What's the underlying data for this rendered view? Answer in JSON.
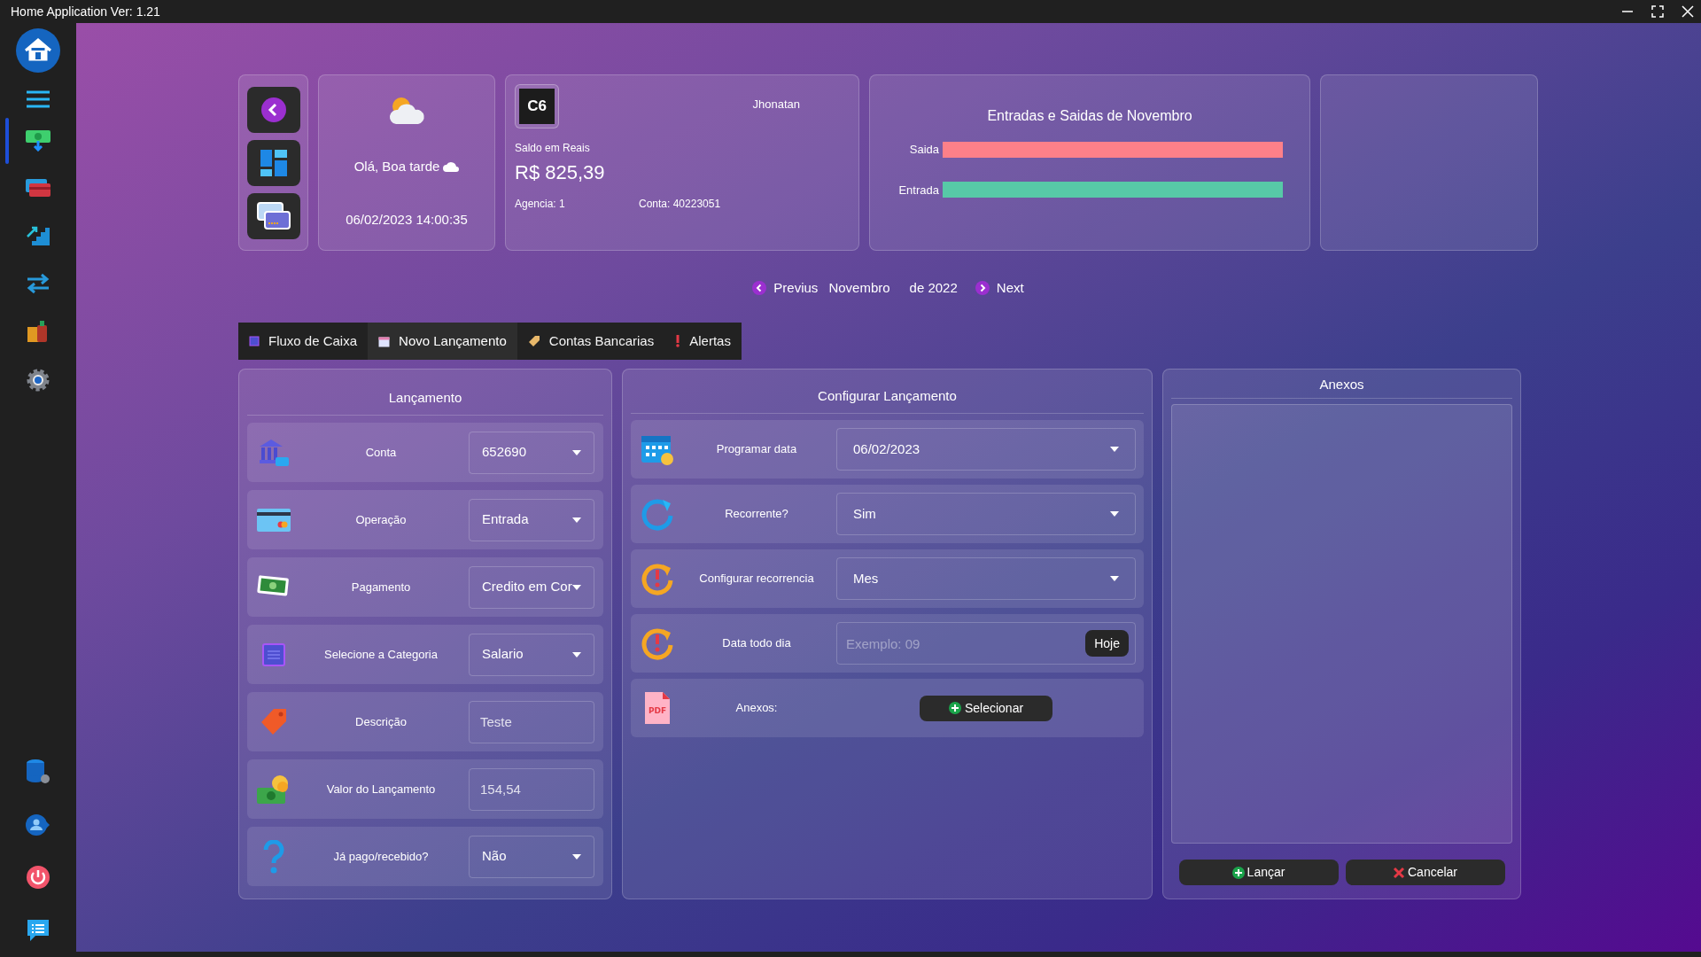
{
  "window": {
    "title": "Home Application Ver: 1.21"
  },
  "sidebar": {
    "items": [
      {
        "selected": true
      },
      {
        "selected": false
      },
      {
        "selected": false
      },
      {
        "selected": false
      },
      {
        "selected": false
      },
      {
        "selected": false
      }
    ]
  },
  "greeting": {
    "text": "Olá, Boa tarde",
    "datetime": "06/02/2023 14:00:35"
  },
  "bank_card": {
    "logo": "C6",
    "owner": "Jhonatan",
    "balance_label": "Saldo em Reais",
    "balance": "R$ 825,39",
    "agency": "Agencia: 1",
    "account": "Conta: 40223051"
  },
  "summary_chart": {
    "title": "Entradas e Saidas de Novembro",
    "bars": [
      {
        "label": "Saida",
        "color": "#fd8089"
      },
      {
        "label": "Entrada",
        "color": "#57c9a7"
      }
    ]
  },
  "pager": {
    "previous": "Previus",
    "month": "Novembro",
    "year": "de 2022",
    "next": "Next"
  },
  "tabs": [
    {
      "label": "Fluxo de Caixa",
      "selected": false
    },
    {
      "label": "Novo Lançamento",
      "selected": true
    },
    {
      "label": "Contas Bancarias",
      "selected": false
    },
    {
      "label": "Alertas",
      "selected": false
    }
  ],
  "entry_panel": {
    "title": "Lançamento",
    "rows": [
      {
        "label": "Conta",
        "kind": "select",
        "value": "652690"
      },
      {
        "label": "Operação",
        "kind": "select",
        "value": "Entrada"
      },
      {
        "label": "Pagamento",
        "kind": "select",
        "value": "Credito em Cor"
      },
      {
        "label": "Selecione a Categoria",
        "kind": "select",
        "value": "Salario"
      },
      {
        "label": "Descrição",
        "kind": "input",
        "value": "Teste"
      },
      {
        "label": "Valor do Lançamento",
        "kind": "input",
        "value": "154,54"
      },
      {
        "label": "Já pago/recebido?",
        "kind": "select",
        "value": "Não"
      }
    ]
  },
  "config_panel": {
    "title": "Configurar Lançamento",
    "rows": [
      {
        "label": "Programar data",
        "kind": "select",
        "value": "06/02/2023"
      },
      {
        "label": "Recorrente?",
        "kind": "select",
        "value": "Sim"
      },
      {
        "label": "Configurar recorrencia",
        "kind": "select",
        "value": "Mes"
      },
      {
        "label": "Data todo dia",
        "kind": "input_button",
        "placeholder": "Exemplo: 09",
        "button": "Hoje"
      },
      {
        "label": "Anexos:",
        "kind": "button",
        "button": "Selecionar",
        "icon_text": "PDF"
      }
    ]
  },
  "attachments_panel": {
    "title": "Anexos",
    "buttons": [
      {
        "label": "Lançar",
        "kind": "confirm"
      },
      {
        "label": "Cancelar",
        "kind": "cancel"
      }
    ]
  }
}
